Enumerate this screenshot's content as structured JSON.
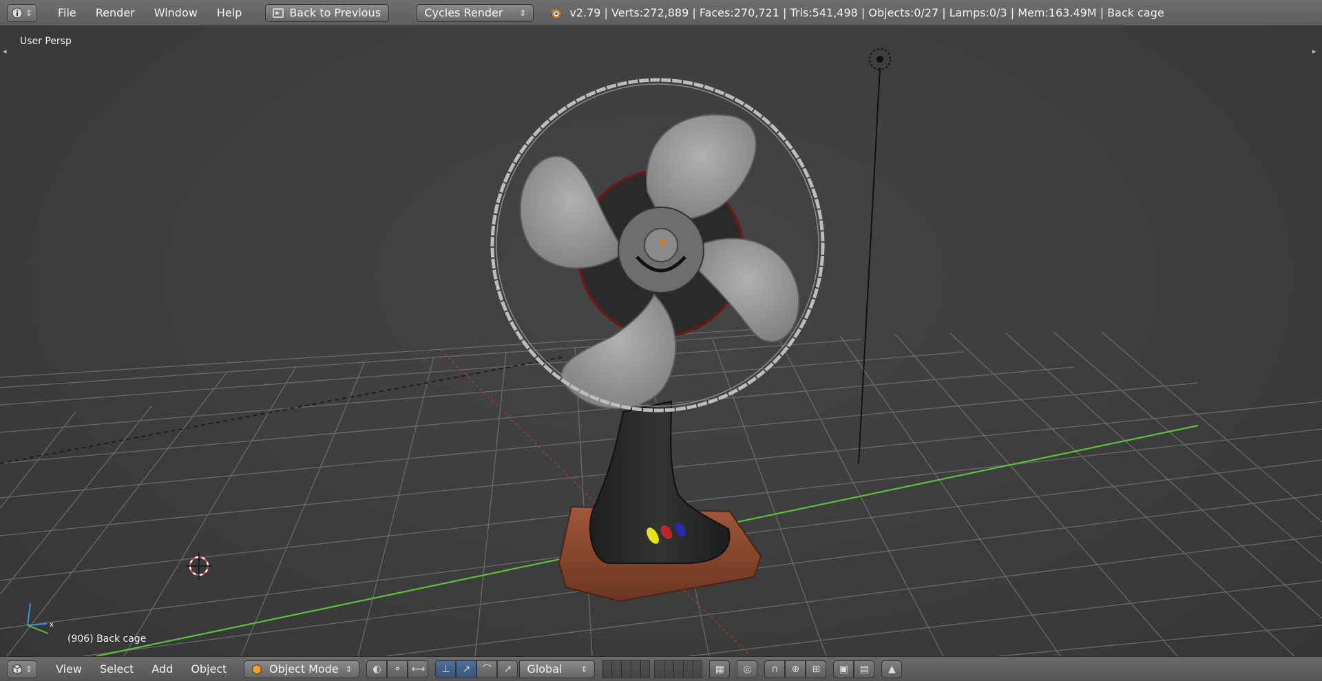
{
  "header": {
    "editor_icon": "info-icon",
    "menu": [
      "File",
      "Render",
      "Window",
      "Help"
    ],
    "back_button": "Back to Previous",
    "render_engine": "Cycles Render",
    "stats": "v2.79 | Verts:272,889 | Faces:270,721 | Tris:541,498 | Objects:0/27 | Lamps:0/3 | Mem:163.49M | Back cage"
  },
  "viewport": {
    "view_label": "User Persp",
    "object_label": "(906) Back cage"
  },
  "footer": {
    "editor_icon": "3d-view-icon",
    "menu": [
      "View",
      "Select",
      "Add",
      "Object"
    ],
    "mode": "Object Mode",
    "orientation": "Global"
  },
  "colors": {
    "header_bg": "#666666",
    "viewport_bg": "#3d3d3d",
    "grid_line": "#6b6b6b",
    "x_axis": "#b03a3a",
    "y_axis": "#5fbf3a",
    "fan_base": "#8a4a2e",
    "fan_body": "#2a2a2a",
    "fan_blade": "#9a9a9a",
    "active_tool": "#4f6f9c"
  }
}
